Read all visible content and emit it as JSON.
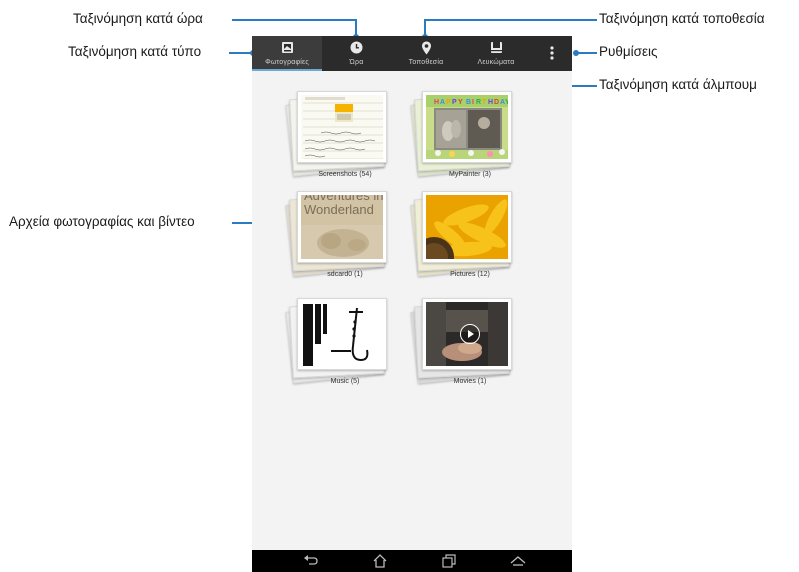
{
  "annotations": {
    "sort_time": "Ταξινόμηση κατά ώρα",
    "sort_type": "Ταξινόμηση κατά τύπο",
    "sort_location": "Ταξινόμηση κατά τοποθεσία",
    "settings": "Ρυθμίσεις",
    "sort_album": "Ταξινόμηση κατά άλμπουμ",
    "files": "Αρχεία φωτογραφίας και βίντεο"
  },
  "tabs": {
    "photos": "Φωτογραφίες",
    "time": "Ώρα",
    "location": "Τοποθεσία",
    "albums": "Λευκώματα"
  },
  "albums": [
    {
      "caption": "Screenshots (54)"
    },
    {
      "caption": "MyPainter (3)"
    },
    {
      "caption": "sdcard0 (1)",
      "thumb_text": "Adventures in Wonderland"
    },
    {
      "caption": "Pictures (12)"
    },
    {
      "caption": "Music (5)"
    },
    {
      "caption": "Movies (1)"
    }
  ],
  "colors": {
    "annotation_line": "#2a7bc0",
    "tabbar": "#2b2b2b",
    "background": "#f3f3f3"
  },
  "icons": [
    "photos-icon",
    "clock-icon",
    "location-pin-icon",
    "album-icon",
    "overflow-menu-icon",
    "back-icon",
    "home-icon",
    "recent-apps-icon",
    "up-icon",
    "play-icon"
  ]
}
